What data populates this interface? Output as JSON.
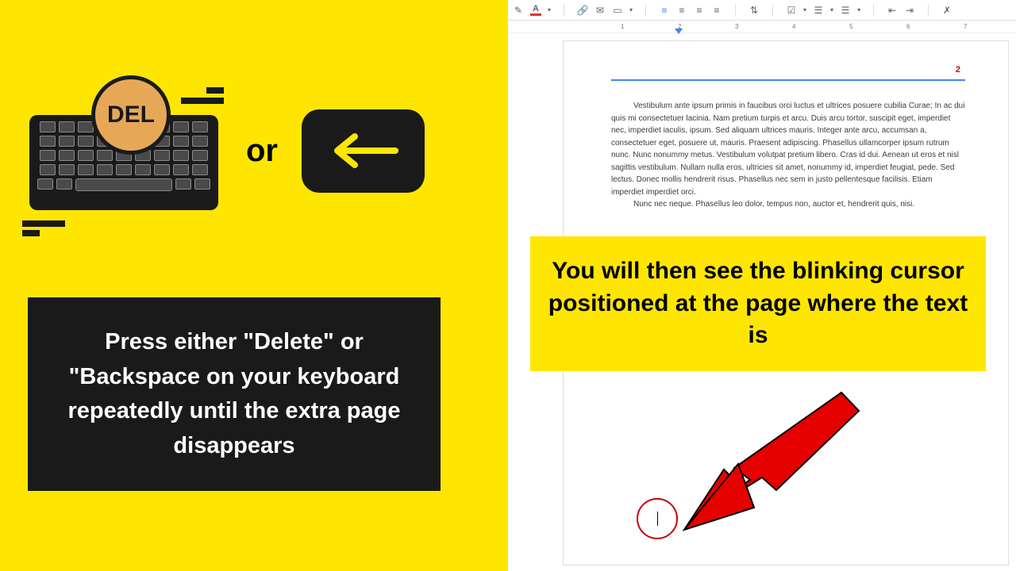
{
  "left": {
    "del_label": "DEL",
    "or_label": "or",
    "instruction": "Press either \"Delete\" or \"Backspace on your keyboard repeatedly until the extra page disappears"
  },
  "right": {
    "callout": "You will then see the blinking cursor positioned at the page where the text is",
    "page_number": "2",
    "toolbar": {
      "font_marker": "A"
    },
    "ruler_marks": [
      "1",
      "2",
      "3",
      "4",
      "5",
      "6",
      "7"
    ],
    "doc_paragraphs": [
      "Vestibulum ante ipsum primis in faucibus orci luctus et ultrices posuere cubilia Curae; In ac dui quis mi consectetuer lacinia. Nam pretium turpis et arcu. Duis arcu tortor, suscipit eget, imperdiet nec, imperdiet iaculis, ipsum. Sed aliquam ultrices mauris. Integer ante arcu, accumsan a, consectetuer eget, posuere ut, mauris. Praesent adipiscing. Phasellus ullamcorper ipsum rutrum nunc. Nunc nonummy metus. Vestibulum volutpat pretium libero. Cras id dui. Aenean ut eros et nisl sagittis vestibulum. Nullam nulla eros, ultricies sit amet, nonummy id, imperdiet feugiat, pede. Sed lectus. Donec mollis hendrerit risus. Phasellus nec sem in justo pellentesque facilisis. Etiam imperdiet imperdiet orci.",
      "Nunc nec neque. Phasellus leo dolor, tempus non, auctor et, hendrerit quis, nisi."
    ]
  }
}
